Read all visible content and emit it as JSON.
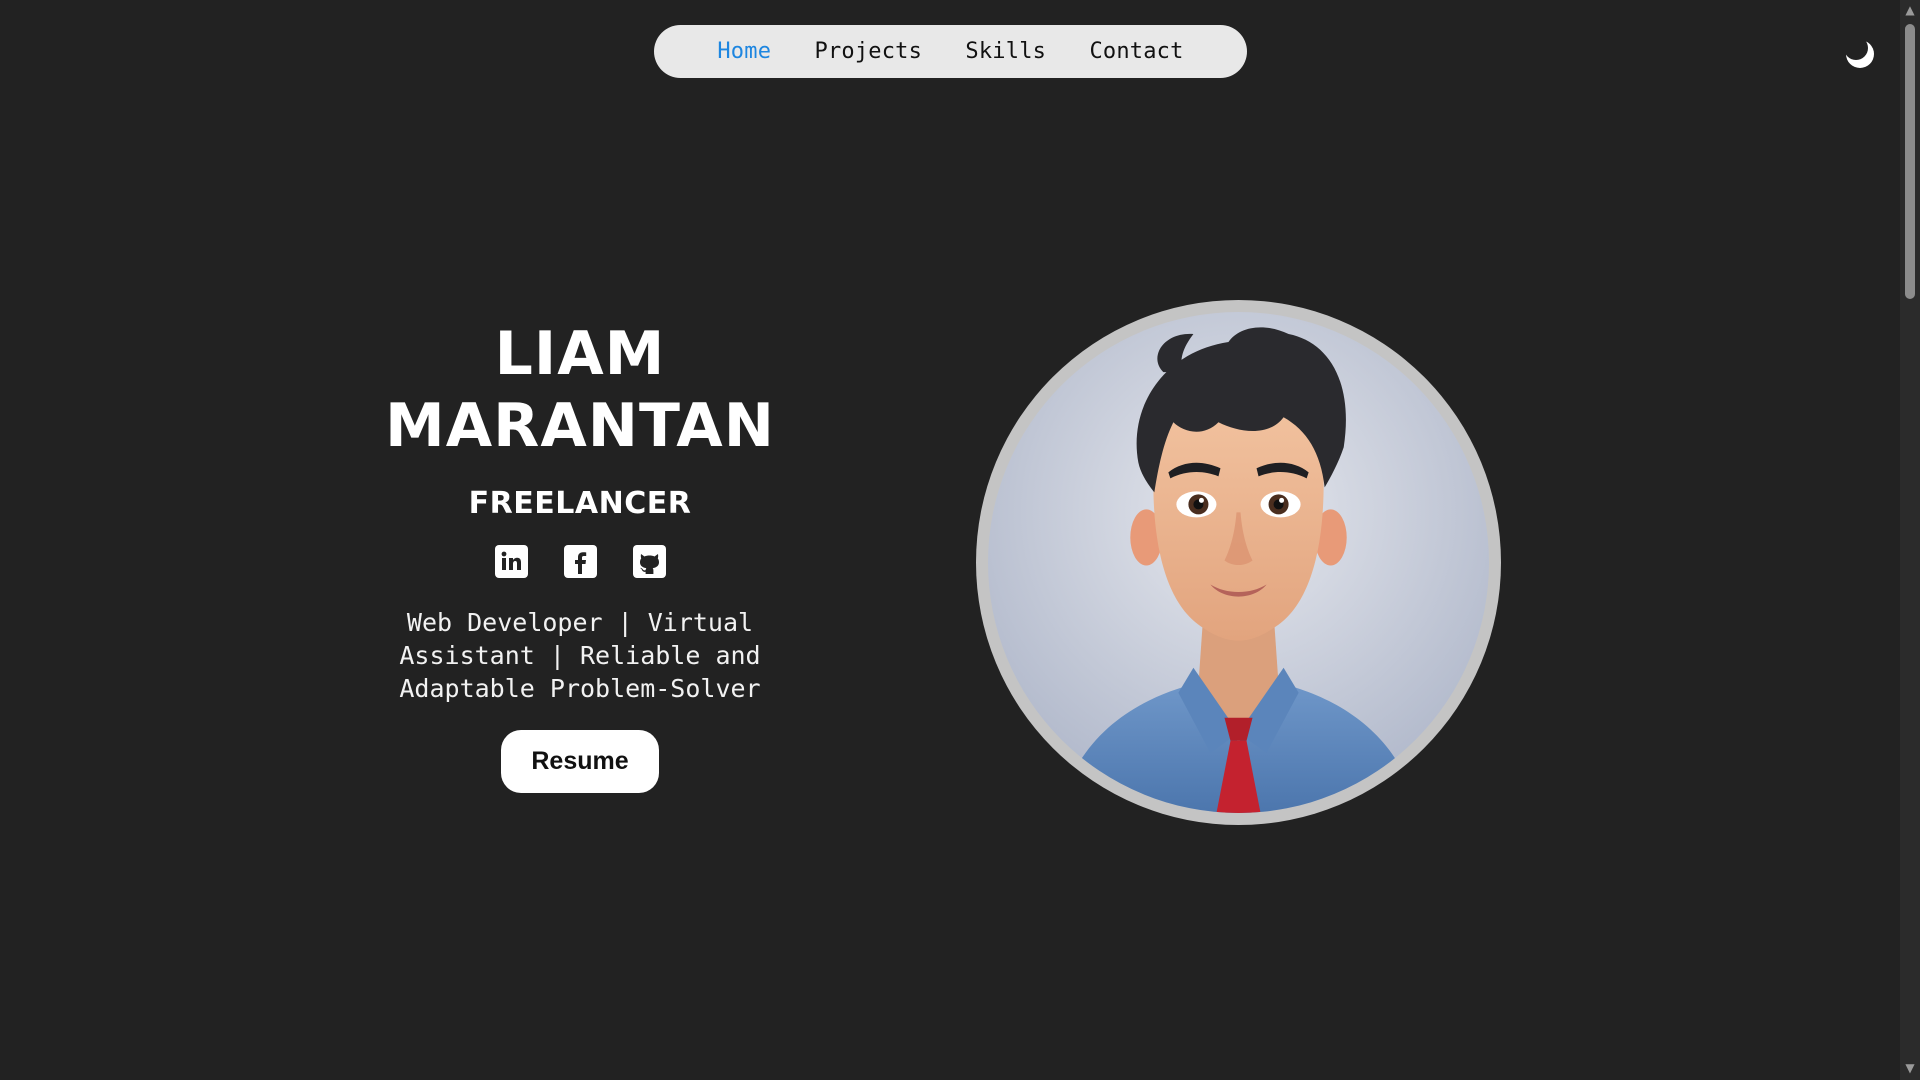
{
  "nav": {
    "items": [
      {
        "label": "Home",
        "active": true
      },
      {
        "label": "Projects",
        "active": false
      },
      {
        "label": "Skills",
        "active": false
      },
      {
        "label": "Contact",
        "active": false
      }
    ]
  },
  "theme_toggle": {
    "icon": "moon-icon"
  },
  "hero": {
    "name_line1": "LIAM",
    "name_line2": "MARANTAN",
    "role": "FREELANCER",
    "tagline": "Web Developer | Virtual Assistant | Reliable and Adaptable Problem-Solver",
    "resume_label": "Resume",
    "socials": [
      {
        "icon": "linkedin-icon"
      },
      {
        "icon": "facebook-icon"
      },
      {
        "icon": "github-icon"
      }
    ],
    "avatar": "cartoon-portrait-avatar"
  },
  "colors": {
    "background": "#222222",
    "nav_bg": "#e8e8e8",
    "accent": "#1e86e0",
    "text": "#ffffff"
  }
}
